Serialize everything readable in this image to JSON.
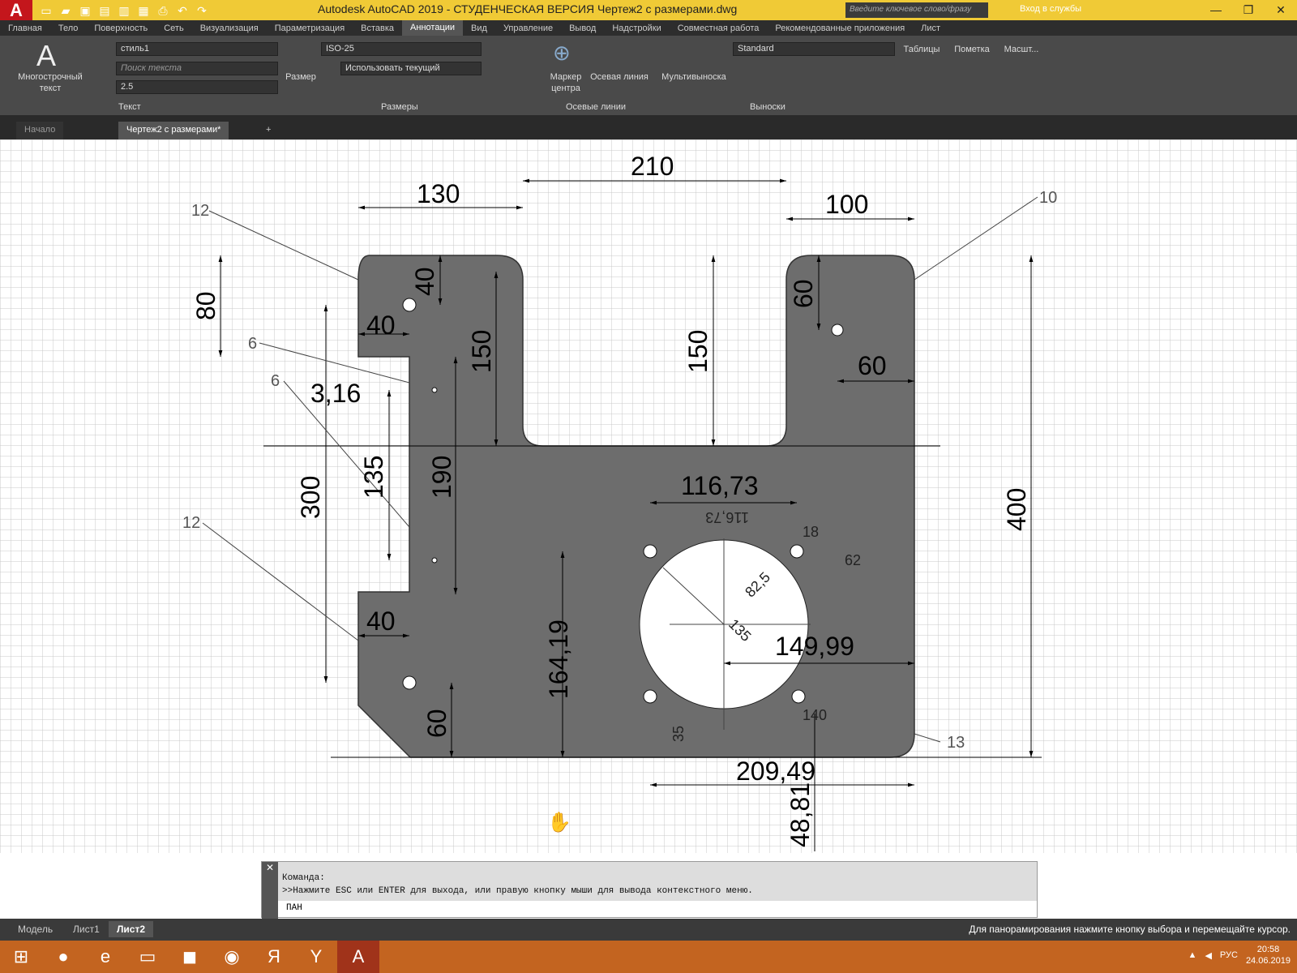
{
  "titlebar": {
    "app_logo": "A",
    "title": "Autodesk AutoCAD 2019 - СТУДЕНЧЕСКАЯ ВЕРСИЯ    Чертеж2 с размерами.dwg",
    "search_placeholder": "Введите ключевое слово/фразу",
    "login": "Вход в службы"
  },
  "ribbon_tabs": [
    "Главная",
    "Тело",
    "Поверхность",
    "Сеть",
    "Визуализация",
    "Параметризация",
    "Вставка",
    "Аннотации",
    "Вид",
    "Управление",
    "Вывод",
    "Надстройки",
    "Совместная работа",
    "Рекомендованные приложения",
    "Лист"
  ],
  "ribbon": {
    "text_panel": {
      "mtext": "Многострочный текст",
      "style": "стиль1",
      "find": "Поиск текста",
      "height": "2.5",
      "label": "Текст"
    },
    "dim_panel": {
      "dim": "Размер",
      "style": "ISO-25",
      "layer": "Использовать текущий",
      "label": "Размеры"
    },
    "center_panel": {
      "marker": "Маркер центра",
      "axis": "Осевая линия",
      "label": "Осевые линии"
    },
    "leader_panel": {
      "mleader": "Мультивыноска",
      "style": "Standard",
      "label": "Выноски"
    },
    "extra": [
      "Таблицы",
      "Пометка",
      "Масшт..."
    ]
  },
  "doc_tabs": {
    "start": "Начало",
    "current": "Чертеж2 с размерами*"
  },
  "drawing": {
    "dims": {
      "d210": "210",
      "d130": "130",
      "d100": "100",
      "d80": "80",
      "d40a": "40",
      "d40b": "40",
      "d40c": "40",
      "d150a": "150",
      "d150b": "150",
      "d60a": "60",
      "d60b": "60",
      "d60c": "60",
      "d316": "3,16",
      "d300": "300",
      "d135": "135",
      "d190": "190",
      "d400": "400",
      "d11673": "116,73",
      "d11673m": "116,73",
      "d18": "18",
      "d62": "62",
      "d825": "82,5",
      "d135b": "135",
      "d14999": "149,99",
      "d16419": "164,19",
      "d140": "140",
      "d35": "35",
      "d20949": "209,49",
      "d4881": "48,81"
    },
    "callouts": {
      "c12a": "12",
      "c12b": "12",
      "c10": "10",
      "c6a": "6",
      "c6b": "6",
      "c13": "13"
    }
  },
  "command": {
    "line1": "Команда:",
    "line2": ">>Нажмите ESC или ENTER для выхода, или правую кнопку мыши для вывода контекстного меню.",
    "input": "ПАН"
  },
  "status": {
    "tabs": [
      "Модель",
      "Лист1",
      "Лист2"
    ],
    "hint": "Для панорамирования нажмите кнопку выбора и перемещайте курсор."
  },
  "taskbar": {
    "lang": "РУС",
    "time": "20:58",
    "date": "24.06.2019"
  }
}
